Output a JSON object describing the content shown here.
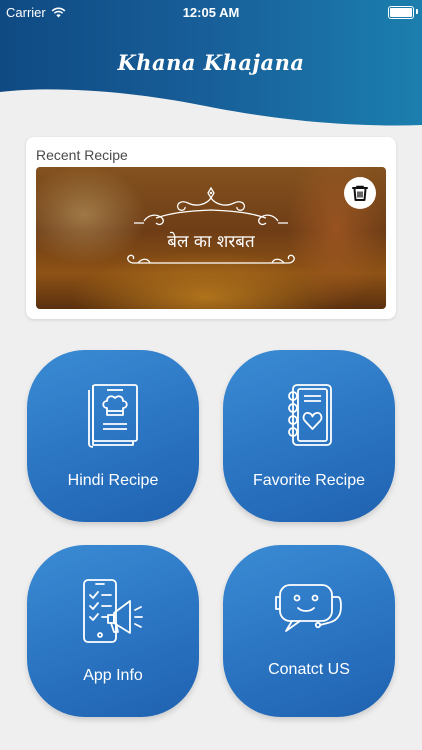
{
  "status_bar": {
    "carrier": "Carrier",
    "time": "12:05 AM"
  },
  "header": {
    "title": "Khana Khajana"
  },
  "recent": {
    "label": "Recent Recipe",
    "recipe_name": "बेल का शरबत"
  },
  "tiles": [
    {
      "label": "Hindi Recipe",
      "icon": "recipe-book-icon"
    },
    {
      "label": "Favorite Recipe",
      "icon": "favorite-notebook-icon"
    },
    {
      "label": "App Info",
      "icon": "app-info-megaphone-icon"
    },
    {
      "label": "Conatct US",
      "icon": "chat-robot-icon"
    }
  ],
  "colors": {
    "header": "#1d5f97",
    "tile": "#2a74c2",
    "background": "#efefef"
  }
}
